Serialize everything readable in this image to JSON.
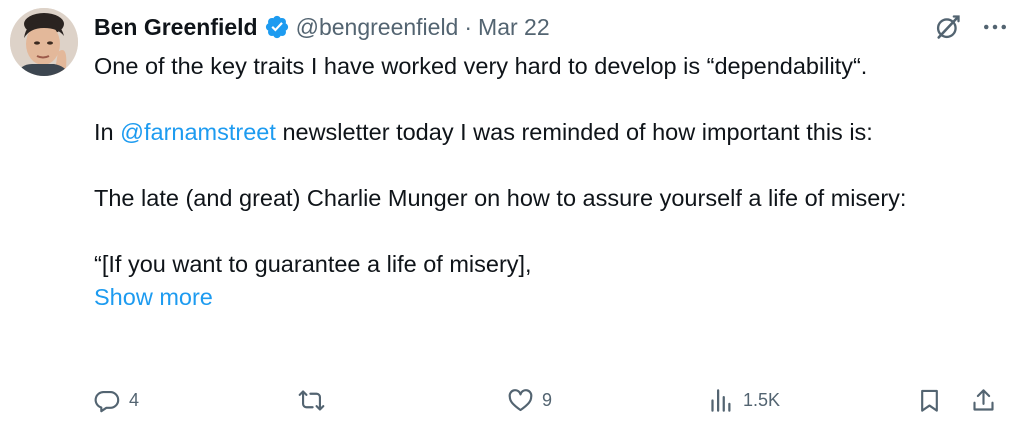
{
  "author": {
    "name": "Ben Greenfield",
    "handle": "@bengreenfield",
    "separator": "·",
    "date": "Mar 22",
    "verified_color": "#1d9bf0"
  },
  "icons": {
    "top_right": [
      "grok-icon",
      "more-icon"
    ],
    "actions": [
      "reply-icon",
      "retweet-icon",
      "like-icon",
      "views-icon",
      "bookmark-icon",
      "share-icon"
    ]
  },
  "body": {
    "line1": "One of the key traits I have worked very hard to develop is “dependability“.",
    "line2_prefix": "In ",
    "line2_mention": "@farnamstreet",
    "line2_suffix": " newsletter today I was reminded of how important this is:",
    "line3": "The late (and great) Charlie Munger on how to assure yourself a life of misery:",
    "line4": "“[If you want to guarantee a life of misery],",
    "show_more": "Show more"
  },
  "metrics": {
    "replies": "4",
    "retweets": "",
    "likes": "9",
    "views": "1.5K"
  },
  "colors": {
    "text": "#0f1419",
    "secondary": "#536471",
    "accent": "#1d9bf0"
  }
}
